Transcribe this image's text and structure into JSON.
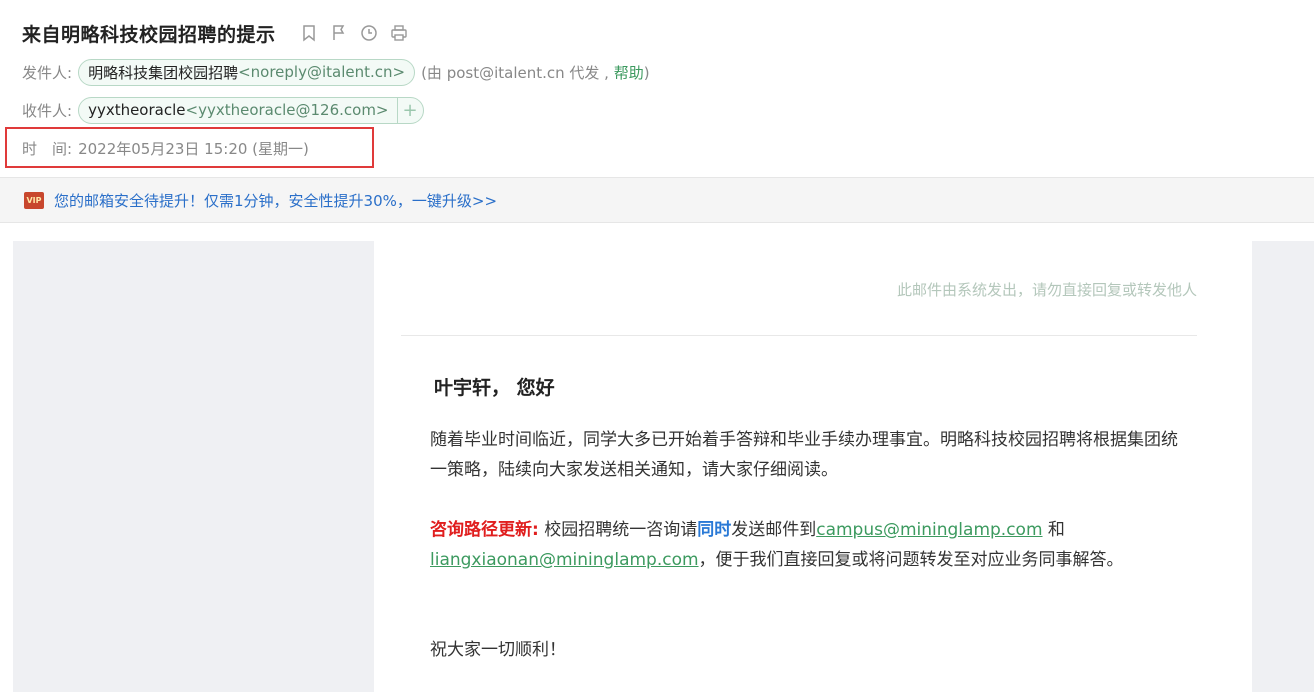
{
  "header": {
    "subject": "来自明略科技校园招聘的提示",
    "tools": [
      "bookmark-icon",
      "flag-icon",
      "clock-icon",
      "print-icon"
    ]
  },
  "from": {
    "label": "发件人:",
    "name": "明略科技集团校园招聘",
    "address": "<noreply@italent.cn>",
    "proxy_prefix": "(由 post@italent.cn 代发 ,",
    "help": "帮助",
    "proxy_suffix": ")"
  },
  "to": {
    "label": "收件人:",
    "name": "yyxtheoracle",
    "address": "<yyxtheoracle@126.com>",
    "add": "+"
  },
  "time": {
    "label": "时　间:",
    "value": "2022年05月23日 15:20 (星期一)"
  },
  "notice": {
    "badge": "VIP",
    "text": "您的邮箱安全待提升！仅需1分钟，安全性提升30%，一键升级>>"
  },
  "mail": {
    "system_note": "此邮件由系统发出，请勿直接回复或转发他人",
    "greeting": "叶宇轩， 您好",
    "p1": "随着毕业时间临近，同学大多已开始着手答辩和毕业手续办理事宜。明略科技校园招聘将根据集团统一策略，陆续向大家发送相关通知，请大家仔细阅读。",
    "p2_head": "咨询路径更新:",
    "p2_a": " 校园招聘统一咨询请",
    "p2_emph": "同时",
    "p2_b": "发送邮件到",
    "p2_mail1": "campus@mininglamp.com",
    "p2_and": " 和 ",
    "p2_mail2": "liangxiaonan@mininglamp.com",
    "p2_c": "，便于我们直接回复或将问题转发至对应业务同事解答。",
    "p3": "祝大家一切顺利！"
  },
  "colors": {
    "accent_green": "#3c9a5f",
    "highlight_red": "#e01e1e",
    "highlight_blue": "#2979d6",
    "annotation_box": "#e03a3a"
  }
}
